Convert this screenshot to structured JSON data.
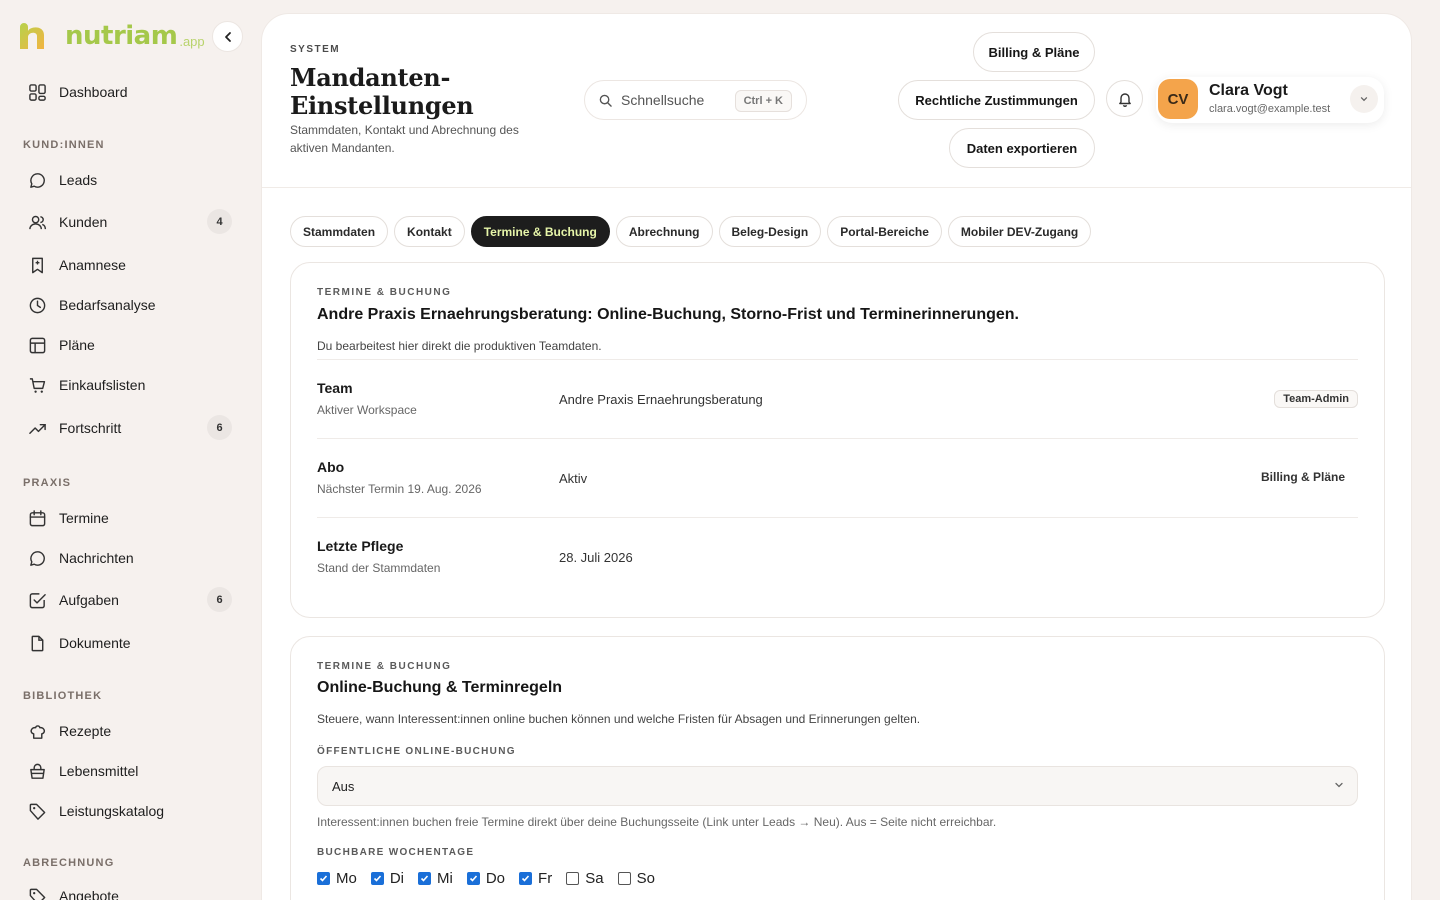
{
  "brand": {
    "name": "nutriam",
    "suffix": ".app"
  },
  "sidebar": {
    "dashboard": "Dashboard",
    "sections": [
      {
        "title": "KUND:INNEN",
        "items": [
          {
            "label": "Leads",
            "icon": "chat-icon"
          },
          {
            "label": "Kunden",
            "icon": "users-icon",
            "badge": "4"
          },
          {
            "label": "Anamnese",
            "icon": "bookmark-icon"
          },
          {
            "label": "Bedarfsanalyse",
            "icon": "clock-icon"
          },
          {
            "label": "Pläne",
            "icon": "table-icon"
          },
          {
            "label": "Einkaufslisten",
            "icon": "cart-icon"
          },
          {
            "label": "Fortschritt",
            "icon": "trend-icon",
            "badge": "6"
          }
        ]
      },
      {
        "title": "PRAXIS",
        "items": [
          {
            "label": "Termine",
            "icon": "calendar-icon"
          },
          {
            "label": "Nachrichten",
            "icon": "chat-icon"
          },
          {
            "label": "Aufgaben",
            "icon": "checkbox-icon",
            "badge": "6"
          },
          {
            "label": "Dokumente",
            "icon": "document-icon"
          }
        ]
      },
      {
        "title": "BIBLIOTHEK",
        "items": [
          {
            "label": "Rezepte",
            "icon": "chef-hat-icon"
          },
          {
            "label": "Lebensmittel",
            "icon": "basket-icon"
          },
          {
            "label": "Leistungskatalog",
            "icon": "tag-icon"
          }
        ]
      },
      {
        "title": "ABRECHNUNG",
        "items": [
          {
            "label": "Angebote",
            "icon": "tag-icon"
          }
        ]
      }
    ]
  },
  "header": {
    "kicker": "SYSTEM",
    "title": "Mandanten-Einstellungen",
    "subtitle": "Stammdaten, Kontakt und Abrechnung des aktiven Mandanten.",
    "search_label": "Schnellsuche",
    "search_shortcut": "Ctrl + K",
    "buttons": {
      "billing": "Billing & Pläne",
      "legal": "Rechtliche Zustimmungen",
      "export": "Daten exportieren"
    },
    "user": {
      "initials": "CV",
      "name": "Clara Vogt",
      "email": "clara.vogt@example.test"
    }
  },
  "tabs": [
    {
      "label": "Stammdaten"
    },
    {
      "label": "Kontakt"
    },
    {
      "label": "Termine & Buchung",
      "active": true
    },
    {
      "label": "Abrechnung"
    },
    {
      "label": "Beleg-Design"
    },
    {
      "label": "Portal-Bereiche"
    },
    {
      "label": "Mobiler DEV-Zugang"
    }
  ],
  "overview": {
    "kicker": "TERMINE & BUCHUNG",
    "title": "Andre Praxis Ernaehrungsberatung: Online-Buchung, Storno-Frist und Terminerinnerungen.",
    "desc": "Du bearbeitest hier direkt die produktiven Teamdaten.",
    "rows": [
      {
        "label": "Team",
        "sub": "Aktiver Workspace",
        "value": "Andre Praxis Ernaehrungsberatung",
        "badge": "Team-Admin"
      },
      {
        "label": "Abo",
        "sub": "Nächster Termin 19. Aug. 2026",
        "value": "Aktiv",
        "link": "Billing & Pläne"
      },
      {
        "label": "Letzte Pflege",
        "sub": "Stand der Stammdaten",
        "value": "28. Juli 2026"
      }
    ]
  },
  "booking": {
    "kicker": "TERMINE & BUCHUNG",
    "title": "Online-Buchung & Terminregeln",
    "desc": "Steuere, wann Interessent:innen online buchen können und welche Fristen für Absagen und Erinnerungen gelten.",
    "public_label": "ÖFFENTLICHE ONLINE-BUCHUNG",
    "public_value": "Aus",
    "public_hint": "Interessent:innen buchen freie Termine direkt über deine Buchungsseite (Link unter Leads → Neu). Aus = Seite nicht erreichbar.",
    "days_label": "BUCHBARE WOCHENTAGE",
    "days": [
      {
        "label": "Mo",
        "checked": true
      },
      {
        "label": "Di",
        "checked": true
      },
      {
        "label": "Mi",
        "checked": true
      },
      {
        "label": "Do",
        "checked": true
      },
      {
        "label": "Fr",
        "checked": true
      },
      {
        "label": "Sa",
        "checked": false
      },
      {
        "label": "So",
        "checked": false
      }
    ]
  }
}
